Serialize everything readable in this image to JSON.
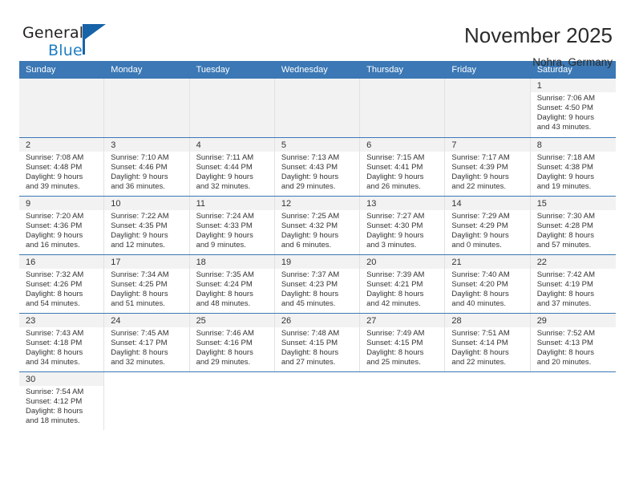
{
  "brand": {
    "name_top": "General",
    "name_bottom": "Blue",
    "accent_color": "#1763a8",
    "text_color": "#231f20"
  },
  "header": {
    "title": "November 2025",
    "subtitle": "Nohra, Germany"
  },
  "theme": {
    "header_blue": "#3b78b5",
    "daynum_band": "#f2f2f2",
    "grid_line": "#e2e2e2"
  },
  "weekday_headers": [
    "Sunday",
    "Monday",
    "Tuesday",
    "Wednesday",
    "Thursday",
    "Friday",
    "Saturday"
  ],
  "weeks": [
    [
      {
        "empty": true
      },
      {
        "empty": true
      },
      {
        "empty": true
      },
      {
        "empty": true
      },
      {
        "empty": true
      },
      {
        "empty": true
      },
      {
        "day": "1",
        "sunrise": "Sunrise: 7:06 AM",
        "sunset": "Sunset: 4:50 PM",
        "daylight1": "Daylight: 9 hours",
        "daylight2": "and 43 minutes."
      }
    ],
    [
      {
        "day": "2",
        "sunrise": "Sunrise: 7:08 AM",
        "sunset": "Sunset: 4:48 PM",
        "daylight1": "Daylight: 9 hours",
        "daylight2": "and 39 minutes."
      },
      {
        "day": "3",
        "sunrise": "Sunrise: 7:10 AM",
        "sunset": "Sunset: 4:46 PM",
        "daylight1": "Daylight: 9 hours",
        "daylight2": "and 36 minutes."
      },
      {
        "day": "4",
        "sunrise": "Sunrise: 7:11 AM",
        "sunset": "Sunset: 4:44 PM",
        "daylight1": "Daylight: 9 hours",
        "daylight2": "and 32 minutes."
      },
      {
        "day": "5",
        "sunrise": "Sunrise: 7:13 AM",
        "sunset": "Sunset: 4:43 PM",
        "daylight1": "Daylight: 9 hours",
        "daylight2": "and 29 minutes."
      },
      {
        "day": "6",
        "sunrise": "Sunrise: 7:15 AM",
        "sunset": "Sunset: 4:41 PM",
        "daylight1": "Daylight: 9 hours",
        "daylight2": "and 26 minutes."
      },
      {
        "day": "7",
        "sunrise": "Sunrise: 7:17 AM",
        "sunset": "Sunset: 4:39 PM",
        "daylight1": "Daylight: 9 hours",
        "daylight2": "and 22 minutes."
      },
      {
        "day": "8",
        "sunrise": "Sunrise: 7:18 AM",
        "sunset": "Sunset: 4:38 PM",
        "daylight1": "Daylight: 9 hours",
        "daylight2": "and 19 minutes."
      }
    ],
    [
      {
        "day": "9",
        "sunrise": "Sunrise: 7:20 AM",
        "sunset": "Sunset: 4:36 PM",
        "daylight1": "Daylight: 9 hours",
        "daylight2": "and 16 minutes."
      },
      {
        "day": "10",
        "sunrise": "Sunrise: 7:22 AM",
        "sunset": "Sunset: 4:35 PM",
        "daylight1": "Daylight: 9 hours",
        "daylight2": "and 12 minutes."
      },
      {
        "day": "11",
        "sunrise": "Sunrise: 7:24 AM",
        "sunset": "Sunset: 4:33 PM",
        "daylight1": "Daylight: 9 hours",
        "daylight2": "and 9 minutes."
      },
      {
        "day": "12",
        "sunrise": "Sunrise: 7:25 AM",
        "sunset": "Sunset: 4:32 PM",
        "daylight1": "Daylight: 9 hours",
        "daylight2": "and 6 minutes."
      },
      {
        "day": "13",
        "sunrise": "Sunrise: 7:27 AM",
        "sunset": "Sunset: 4:30 PM",
        "daylight1": "Daylight: 9 hours",
        "daylight2": "and 3 minutes."
      },
      {
        "day": "14",
        "sunrise": "Sunrise: 7:29 AM",
        "sunset": "Sunset: 4:29 PM",
        "daylight1": "Daylight: 9 hours",
        "daylight2": "and 0 minutes."
      },
      {
        "day": "15",
        "sunrise": "Sunrise: 7:30 AM",
        "sunset": "Sunset: 4:28 PM",
        "daylight1": "Daylight: 8 hours",
        "daylight2": "and 57 minutes."
      }
    ],
    [
      {
        "day": "16",
        "sunrise": "Sunrise: 7:32 AM",
        "sunset": "Sunset: 4:26 PM",
        "daylight1": "Daylight: 8 hours",
        "daylight2": "and 54 minutes."
      },
      {
        "day": "17",
        "sunrise": "Sunrise: 7:34 AM",
        "sunset": "Sunset: 4:25 PM",
        "daylight1": "Daylight: 8 hours",
        "daylight2": "and 51 minutes."
      },
      {
        "day": "18",
        "sunrise": "Sunrise: 7:35 AM",
        "sunset": "Sunset: 4:24 PM",
        "daylight1": "Daylight: 8 hours",
        "daylight2": "and 48 minutes."
      },
      {
        "day": "19",
        "sunrise": "Sunrise: 7:37 AM",
        "sunset": "Sunset: 4:23 PM",
        "daylight1": "Daylight: 8 hours",
        "daylight2": "and 45 minutes."
      },
      {
        "day": "20",
        "sunrise": "Sunrise: 7:39 AM",
        "sunset": "Sunset: 4:21 PM",
        "daylight1": "Daylight: 8 hours",
        "daylight2": "and 42 minutes."
      },
      {
        "day": "21",
        "sunrise": "Sunrise: 7:40 AM",
        "sunset": "Sunset: 4:20 PM",
        "daylight1": "Daylight: 8 hours",
        "daylight2": "and 40 minutes."
      },
      {
        "day": "22",
        "sunrise": "Sunrise: 7:42 AM",
        "sunset": "Sunset: 4:19 PM",
        "daylight1": "Daylight: 8 hours",
        "daylight2": "and 37 minutes."
      }
    ],
    [
      {
        "day": "23",
        "sunrise": "Sunrise: 7:43 AM",
        "sunset": "Sunset: 4:18 PM",
        "daylight1": "Daylight: 8 hours",
        "daylight2": "and 34 minutes."
      },
      {
        "day": "24",
        "sunrise": "Sunrise: 7:45 AM",
        "sunset": "Sunset: 4:17 PM",
        "daylight1": "Daylight: 8 hours",
        "daylight2": "and 32 minutes."
      },
      {
        "day": "25",
        "sunrise": "Sunrise: 7:46 AM",
        "sunset": "Sunset: 4:16 PM",
        "daylight1": "Daylight: 8 hours",
        "daylight2": "and 29 minutes."
      },
      {
        "day": "26",
        "sunrise": "Sunrise: 7:48 AM",
        "sunset": "Sunset: 4:15 PM",
        "daylight1": "Daylight: 8 hours",
        "daylight2": "and 27 minutes."
      },
      {
        "day": "27",
        "sunrise": "Sunrise: 7:49 AM",
        "sunset": "Sunset: 4:15 PM",
        "daylight1": "Daylight: 8 hours",
        "daylight2": "and 25 minutes."
      },
      {
        "day": "28",
        "sunrise": "Sunrise: 7:51 AM",
        "sunset": "Sunset: 4:14 PM",
        "daylight1": "Daylight: 8 hours",
        "daylight2": "and 22 minutes."
      },
      {
        "day": "29",
        "sunrise": "Sunrise: 7:52 AM",
        "sunset": "Sunset: 4:13 PM",
        "daylight1": "Daylight: 8 hours",
        "daylight2": "and 20 minutes."
      }
    ],
    [
      {
        "day": "30",
        "sunrise": "Sunrise: 7:54 AM",
        "sunset": "Sunset: 4:12 PM",
        "daylight1": "Daylight: 8 hours",
        "daylight2": "and 18 minutes."
      },
      {
        "blank": true
      },
      {
        "blank": true
      },
      {
        "blank": true
      },
      {
        "blank": true
      },
      {
        "blank": true
      },
      {
        "blank": true
      }
    ]
  ]
}
